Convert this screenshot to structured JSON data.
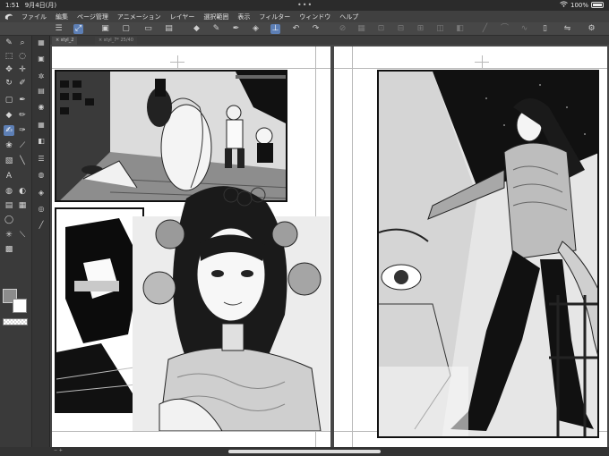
{
  "status": {
    "time": "1:51",
    "date": "9月4日(月)",
    "dots": "•••",
    "battery": "100%"
  },
  "menubar": {
    "items": [
      "ファイル",
      "編集",
      "ページ管理",
      "アニメーション",
      "レイヤー",
      "選択範囲",
      "表示",
      "フィルター",
      "ウィンドウ",
      "ヘルプ"
    ]
  },
  "tabs": [
    {
      "label": "× styl_2",
      "active": true
    },
    {
      "label": "× styl_7*  25/40",
      "active": false
    }
  ],
  "colors": {
    "accent": "#5d7fb5",
    "main_color": "#8c8c8c",
    "sub_color": "#ffffff"
  },
  "tools": {
    "left_icons": [
      "pen-icon",
      "magnifier-icon",
      "select-icon",
      "lasso-icon",
      "move-icon",
      "crosshair-icon",
      "rotate-icon",
      "eyedropper-icon",
      "rectangle-icon",
      "pen-nib-icon",
      "eraser-icon",
      "brush-icon",
      "pencil-icon",
      "airbrush-icon",
      "blend-icon",
      "ruler-icon",
      "text-icon",
      "bucket-icon",
      "gradient-icon",
      "frame-icon",
      "figure-icon",
      "speech-bubble-icon",
      "line-icon",
      "decoration-icon"
    ],
    "sub_icons": [
      "layer-icon",
      "page-icon",
      "star-icon",
      "image-icon",
      "shapes-icon",
      "grid-icon",
      "adjust-icon",
      "list-icon",
      "palette-icon",
      "stack-icon"
    ]
  }
}
